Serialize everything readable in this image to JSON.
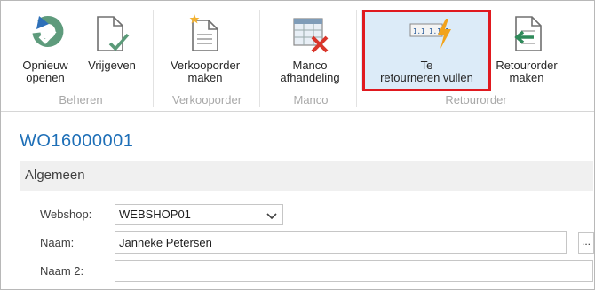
{
  "ribbon": {
    "buttons": {
      "reopen": "Opnieuw\nopenen",
      "release": "Vrijgeven",
      "make_sales_order": "Verkooporder\nmaken",
      "shortage_handling": "Manco\nafhandeling",
      "fill_returns": "Te\nretourneren vullen",
      "make_return_order": "Retourorder\nmaken"
    },
    "groups": {
      "manage": "Beheren",
      "sales_order": "Verkooporder",
      "shortage": "Manco",
      "return_order": "Retourorder"
    },
    "icon_number_text": "1.1 1.1 1"
  },
  "page": {
    "title": "WO16000001",
    "section": "Algemeen"
  },
  "fields": {
    "webshop": {
      "label": "Webshop:",
      "value": "WEBSHOP01"
    },
    "name": {
      "label": "Naam:",
      "value": "Janneke Petersen"
    },
    "name2": {
      "label": "Naam 2:",
      "value": ""
    }
  },
  "assist_label": "...",
  "colors": {
    "title_blue": "#1e6fb7",
    "highlight": "#dcebf8",
    "callout_red": "#e0191f"
  }
}
